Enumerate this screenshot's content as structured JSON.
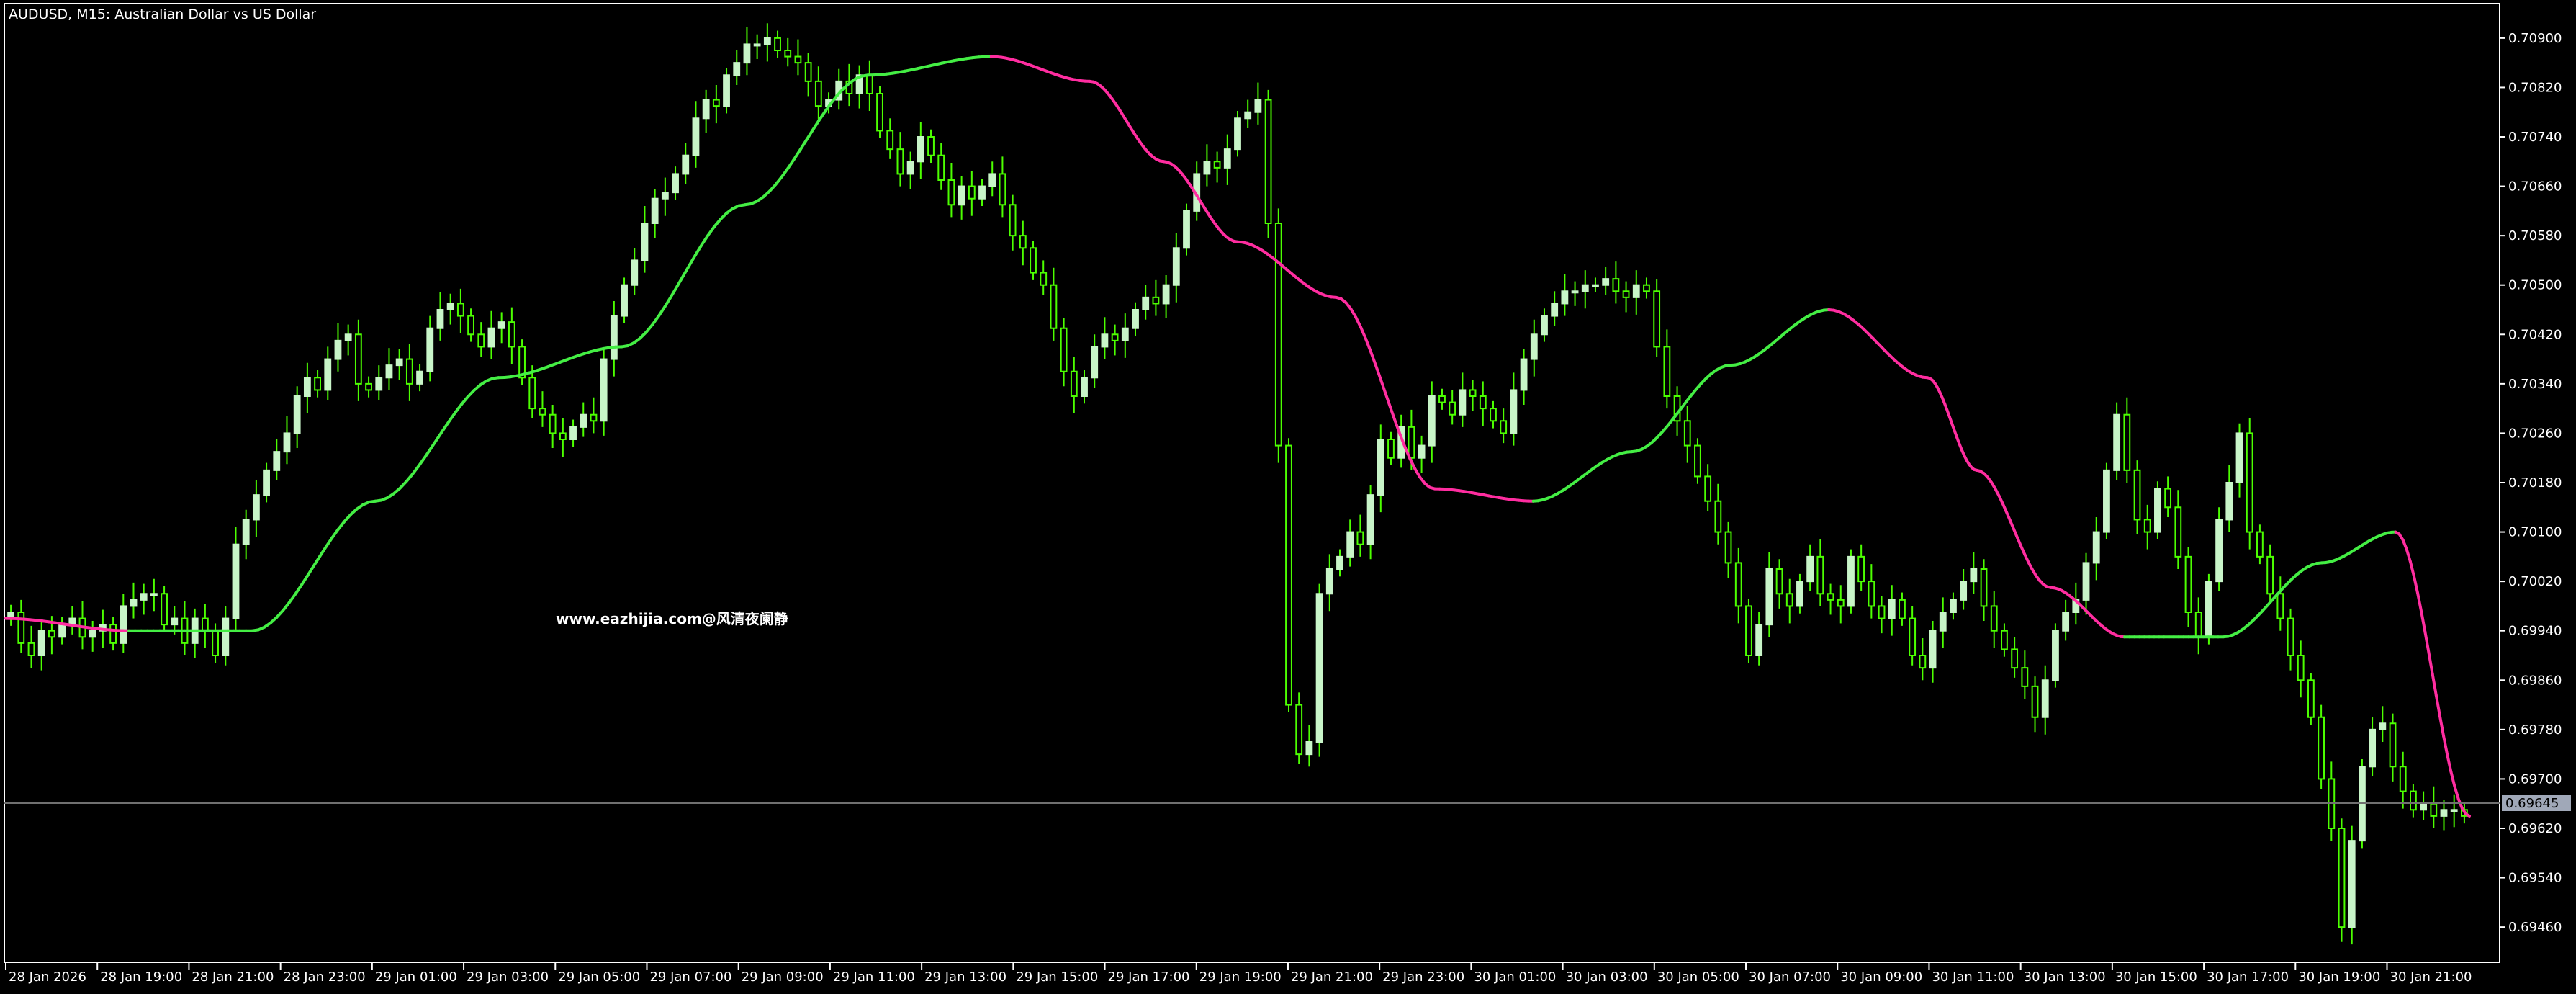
{
  "window": {
    "symbol_title": "AUDUSD, M15:  Australian Dollar vs US Dollar",
    "watermark": "www.eazhijia.com@风清夜阑静",
    "current_price": "0.69645"
  },
  "colors": {
    "background": "#000000",
    "frame": "#ffffff",
    "candle_up": "#c8f5c8",
    "candle_down_border": "#4cff00",
    "wick": "#4cff00",
    "ma_up": "#44ee44",
    "ma_down": "#ff2da0",
    "price_line": "#707070",
    "price_tag_bg": "#a0a8b8"
  },
  "chart_data": {
    "type": "candlestick",
    "y_ticks": [
      "0.70900",
      "0.70820",
      "0.70740",
      "0.70660",
      "0.70580",
      "0.70500",
      "0.70420",
      "0.70340",
      "0.70260",
      "0.70180",
      "0.70100",
      "0.70020",
      "0.69940",
      "0.69860",
      "0.69780",
      "0.69700",
      "0.69620",
      "0.69540",
      "0.69460"
    ],
    "ylim": [
      0.6941,
      0.7095
    ],
    "x_ticks": [
      "28 Jan 2026",
      "28 Jan 19:00",
      "28 Jan 21:00",
      "28 Jan 23:00",
      "29 Jan 01:00",
      "29 Jan 03:00",
      "29 Jan 05:00",
      "29 Jan 07:00",
      "29 Jan 09:00",
      "29 Jan 11:00",
      "29 Jan 13:00",
      "29 Jan 15:00",
      "29 Jan 17:00",
      "29 Jan 19:00",
      "29 Jan 21:00",
      "29 Jan 23:00",
      "30 Jan 01:00",
      "30 Jan 03:00",
      "30 Jan 05:00",
      "30 Jan 07:00",
      "30 Jan 09:00",
      "30 Jan 11:00",
      "30 Jan 13:00",
      "30 Jan 15:00",
      "30 Jan 17:00",
      "30 Jan 19:00",
      "30 Jan 21:00"
    ],
    "close_path": [
      0.6997,
      0.6992,
      0.699,
      0.6994,
      0.6993,
      0.6995,
      0.6996,
      0.6993,
      0.6994,
      0.6995,
      0.6992,
      0.6998,
      0.6999,
      0.7,
      0.7,
      0.6995,
      0.6996,
      0.6992,
      0.6996,
      0.6994,
      0.699,
      0.6996,
      0.7008,
      0.7012,
      0.7016,
      0.702,
      0.7023,
      0.7026,
      0.7032,
      0.7035,
      0.7033,
      0.7038,
      0.7041,
      0.7042,
      0.7034,
      0.7033,
      0.7035,
      0.7037,
      0.7038,
      0.7034,
      0.7036,
      0.7043,
      0.7046,
      0.7047,
      0.7045,
      0.7042,
      0.704,
      0.7043,
      0.7044,
      0.704,
      0.7035,
      0.703,
      0.7029,
      0.7026,
      0.7025,
      0.7027,
      0.7029,
      0.7028,
      0.7038,
      0.7045,
      0.705,
      0.7054,
      0.706,
      0.7064,
      0.7065,
      0.7068,
      0.7071,
      0.7077,
      0.708,
      0.7079,
      0.7084,
      0.7086,
      0.7089,
      0.7089,
      0.709,
      0.7088,
      0.7087,
      0.7086,
      0.7083,
      0.7079,
      0.708,
      0.7083,
      0.7081,
      0.7084,
      0.7081,
      0.7075,
      0.7072,
      0.7068,
      0.707,
      0.7074,
      0.7071,
      0.7067,
      0.7063,
      0.7066,
      0.7064,
      0.7066,
      0.7068,
      0.7063,
      0.7058,
      0.7056,
      0.7052,
      0.705,
      0.7043,
      0.7036,
      0.7032,
      0.7035,
      0.704,
      0.7042,
      0.7041,
      0.7043,
      0.7046,
      0.7048,
      0.7047,
      0.705,
      0.7056,
      0.7062,
      0.7068,
      0.707,
      0.7069,
      0.7072,
      0.7077,
      0.7078,
      0.708,
      0.706,
      0.7024,
      0.6982,
      0.6974,
      0.6976,
      0.7,
      0.7004,
      0.7006,
      0.701,
      0.7008,
      0.7016,
      0.7025,
      0.7022,
      0.7027,
      0.7022,
      0.7024,
      0.7032,
      0.7031,
      0.7029,
      0.7033,
      0.7032,
      0.703,
      0.7028,
      0.7026,
      0.7033,
      0.7038,
      0.7042,
      0.7045,
      0.7047,
      0.7049,
      0.7049,
      0.705,
      0.705,
      0.7051,
      0.7049,
      0.7048,
      0.705,
      0.7049,
      0.704,
      0.7032,
      0.7028,
      0.7024,
      0.7019,
      0.7015,
      0.701,
      0.7005,
      0.6998,
      0.699,
      0.6995,
      0.7004,
      0.7,
      0.6998,
      0.7002,
      0.7006,
      0.7,
      0.6999,
      0.6998,
      0.7006,
      0.7002,
      0.6998,
      0.6996,
      0.6999,
      0.6996,
      0.699,
      0.6988,
      0.6994,
      0.6997,
      0.6999,
      0.7002,
      0.7004,
      0.6998,
      0.6994,
      0.6991,
      0.6988,
      0.6985,
      0.698,
      0.6986,
      0.6994,
      0.6997,
      0.6999,
      0.7005,
      0.701,
      0.702,
      0.7029,
      0.702,
      0.7012,
      0.701,
      0.7017,
      0.7014,
      0.7006,
      0.6997,
      0.6993,
      0.7002,
      0.7012,
      0.7018,
      0.7026,
      0.701,
      0.7006,
      0.7,
      0.6996,
      0.699,
      0.6986,
      0.698,
      0.697,
      0.6962,
      0.6946,
      0.696,
      0.6972,
      0.6978,
      0.6979,
      0.6972,
      0.6968,
      0.6965,
      0.6966,
      0.6964,
      0.6965,
      0.6965,
      0.6964
    ],
    "ma_path": [
      [
        0.0,
        0.6996
      ],
      [
        0.05,
        0.6994
      ],
      [
        0.1,
        0.6994
      ],
      [
        0.15,
        0.7015
      ],
      [
        0.2,
        0.7035
      ],
      [
        0.25,
        0.704
      ],
      [
        0.3,
        0.7063
      ],
      [
        0.35,
        0.7084
      ],
      [
        0.4,
        0.7087
      ],
      [
        0.44,
        0.7083
      ],
      [
        0.47,
        0.707
      ],
      [
        0.5,
        0.7057
      ],
      [
        0.54,
        0.7048
      ],
      [
        0.58,
        0.7017
      ],
      [
        0.62,
        0.7015
      ],
      [
        0.66,
        0.7023
      ],
      [
        0.7,
        0.7037
      ],
      [
        0.74,
        0.7046
      ],
      [
        0.78,
        0.7035
      ],
      [
        0.8,
        0.702
      ],
      [
        0.83,
        0.7001
      ],
      [
        0.86,
        0.6993
      ],
      [
        0.9,
        0.6993
      ],
      [
        0.94,
        0.7005
      ],
      [
        0.97,
        0.701
      ],
      [
        1.0,
        0.6964
      ]
    ]
  }
}
